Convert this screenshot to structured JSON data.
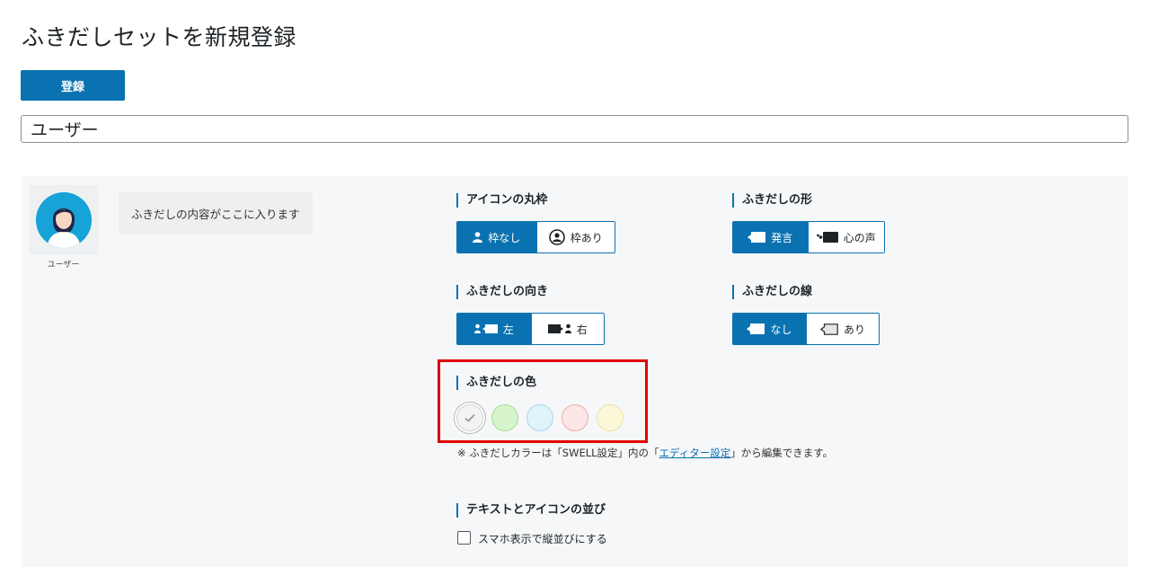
{
  "page": {
    "title": "ふきだしセットを新規登録"
  },
  "toolbar": {
    "register_label": "登録"
  },
  "name_field": {
    "value": "ユーザー"
  },
  "preview": {
    "name": "ユーザー",
    "bubble_text": "ふきだしの内容がここに入ります"
  },
  "sections": {
    "icon_frame": {
      "label": "アイコンの丸枠",
      "options": [
        "枠なし",
        "枠あり"
      ],
      "selected": "枠なし"
    },
    "bubble_shape": {
      "label": "ふきだしの形",
      "options": [
        "発言",
        "心の声"
      ],
      "selected": "発言"
    },
    "bubble_direction": {
      "label": "ふきだしの向き",
      "options": [
        "左",
        "右"
      ],
      "selected": "左"
    },
    "bubble_line": {
      "label": "ふきだしの線",
      "options": [
        "なし",
        "あり"
      ],
      "selected": "なし"
    },
    "bubble_color": {
      "label": "ふきだしの色",
      "swatches": [
        {
          "name": "gray",
          "bg": "#f3f3f3",
          "border": "#d0d0d0",
          "selected": true
        },
        {
          "name": "green",
          "bg": "#d6f5cd",
          "border": "#a6dd96"
        },
        {
          "name": "blue",
          "bg": "#e0f3fb",
          "border": "#a9d7ee"
        },
        {
          "name": "red",
          "bg": "#fde6e6",
          "border": "#f2a8ac"
        },
        {
          "name": "yellow",
          "bg": "#fbf7d9",
          "border": "#eee2a0"
        }
      ],
      "note_prefix": "※ ふきだしカラーは「SWELL設定」内の「",
      "note_link": "エディター設定",
      "note_suffix": "」から編集できます。"
    },
    "text_icon_order": {
      "label": "テキストとアイコンの並び",
      "checkbox_label": "スマホ表示で縦並びにする",
      "checked": false
    }
  },
  "colors": {
    "accent": "#0a72b1",
    "highlight": "#e00000"
  }
}
